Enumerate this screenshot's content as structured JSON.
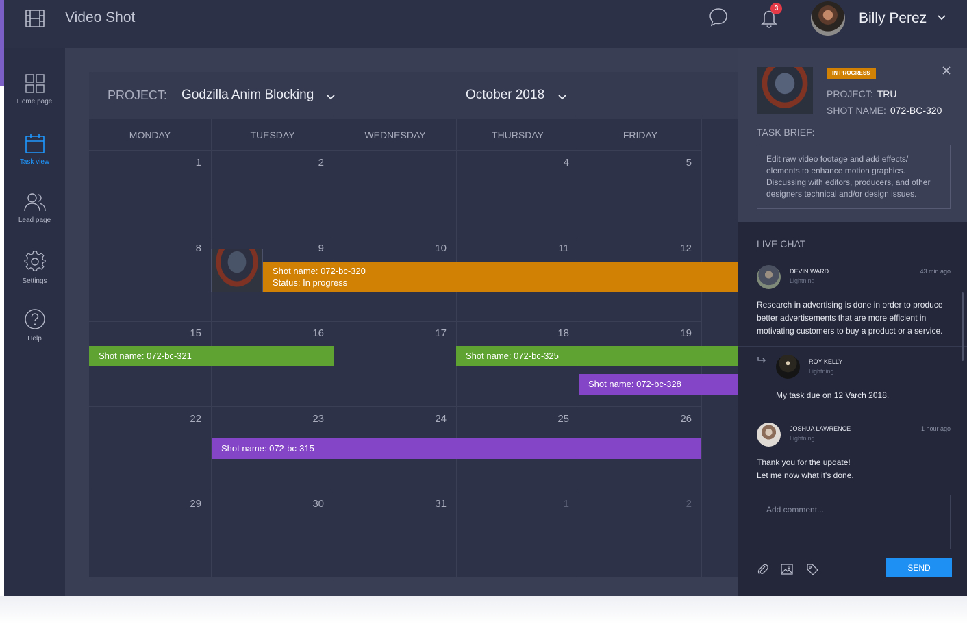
{
  "app": {
    "title": "Video Shot",
    "notification_count": "3",
    "user_name": "Billy Perez"
  },
  "sidebar": {
    "items": [
      {
        "label": "Home page",
        "icon": "grid-icon"
      },
      {
        "label": "Task view",
        "icon": "calendar-icon",
        "active": true
      },
      {
        "label": "Lead page",
        "icon": "users-icon"
      },
      {
        "label": "Settings",
        "icon": "gear-icon"
      },
      {
        "label": "Help",
        "icon": "help-icon"
      }
    ]
  },
  "calendar": {
    "project_label": "PROJECT:",
    "project_name": "Godzilla Anim Blocking",
    "month": "October 2018",
    "days": [
      "MONDAY",
      "TUESDAY",
      "WEDNESDAY",
      "THURSDAY",
      "FRIDAY"
    ],
    "weeks": [
      [
        "1",
        "2",
        "",
        "4",
        "5"
      ],
      [
        "8",
        "9",
        "10",
        "11",
        "12"
      ],
      [
        "15",
        "16",
        "17",
        "18",
        "19"
      ],
      [
        "22",
        "23",
        "24",
        "25",
        "26"
      ],
      [
        "29",
        "30",
        "31",
        "1",
        "2"
      ]
    ],
    "events": [
      {
        "line1": "Shot name: 072-bc-320",
        "line2": "Status: In progress",
        "color": "#d18104"
      },
      {
        "label": "Shot name: 072-bc-321",
        "color": "#5fa332"
      },
      {
        "label": "Shot name: 072-bc-325",
        "color": "#5fa332"
      },
      {
        "label": "Shot name: 072-bc-328",
        "color": "#8445c6"
      },
      {
        "label": "Shot name: 072-bc-315",
        "color": "#8445c6"
      }
    ]
  },
  "task_panel": {
    "status": "IN PROGRESS",
    "project_label": "PROJECT:",
    "project_value": "TRU",
    "shot_label": "SHOT NAME:",
    "shot_value": "072-BC-320",
    "brief_title": "TASK BRIEF:",
    "brief_text": "Edit raw video footage and add effects/ elements to enhance motion graphics. Discussing with editors, producers, and other designers technical and/or design issues."
  },
  "live_chat": {
    "title": "LIVE CHAT",
    "messages": [
      {
        "name": "DEVIN WARD",
        "role": "Lightning",
        "time": "43 min ago",
        "text": "Research in advertising is done in order to produce better advertisements that are more efficient in motivating customers to buy a product or a service."
      },
      {
        "name": "ROY KELLY",
        "role": "Lightning",
        "time": "",
        "text": "My task due on 12 Varch 2018."
      },
      {
        "name": "JOSHUA LAWRENCE",
        "role": "Lightning",
        "time": "1 hour ago",
        "text_line1": "Thank you for the update!",
        "text_line2": "Let me now what it's done."
      }
    ],
    "comment_placeholder": "Add comment...",
    "send_label": "SEND"
  },
  "colors": {
    "accent_blue": "#1e8ff3",
    "in_progress": "#d18104",
    "green": "#5fa332",
    "purple": "#8445c6",
    "badge_red": "#e43a47"
  }
}
